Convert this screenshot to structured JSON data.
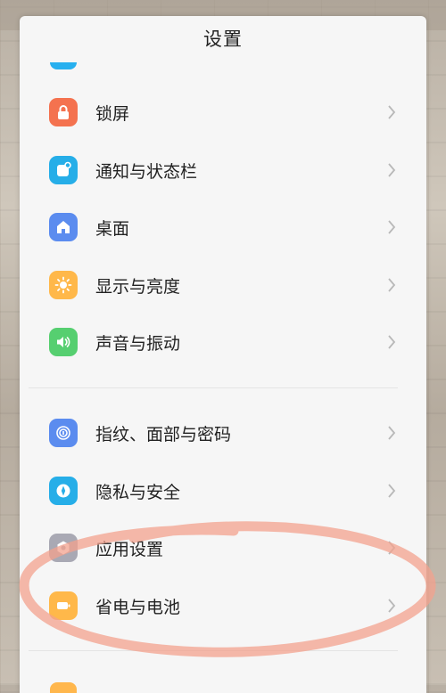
{
  "header": {
    "title": "设置"
  },
  "colors": {
    "lockscreen": "#f4724f",
    "notifications": "#26aee8",
    "desktop": "#5b8cef",
    "display": "#ffb84a",
    "sound": "#56cf70",
    "fingerprint": "#5b8cef",
    "privacy": "#26aee8",
    "apps": "#a9a9b4",
    "battery": "#ffb84a",
    "annotation": "#f3a18e"
  },
  "settings": {
    "group1": [
      {
        "label": "锁屏",
        "icon": "lock-icon"
      },
      {
        "label": "通知与状态栏",
        "icon": "notification-icon"
      },
      {
        "label": "桌面",
        "icon": "home-icon"
      },
      {
        "label": "显示与亮度",
        "icon": "brightness-icon"
      },
      {
        "label": "声音与振动",
        "icon": "speaker-icon"
      }
    ],
    "group2": [
      {
        "label": "指纹、面部与密码",
        "icon": "fingerprint-icon"
      },
      {
        "label": "隐私与安全",
        "icon": "privacy-icon"
      },
      {
        "label": "应用设置",
        "icon": "app-settings-icon"
      },
      {
        "label": "省电与电池",
        "icon": "battery-icon"
      }
    ]
  }
}
